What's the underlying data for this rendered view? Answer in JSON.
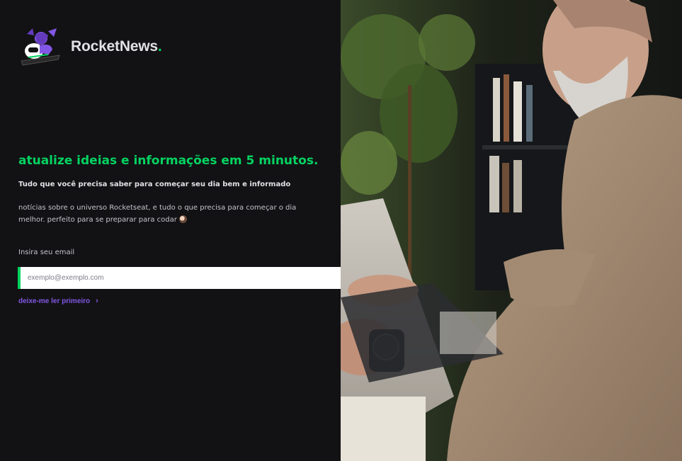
{
  "brand": {
    "name": "RocketNews",
    "dot": ".",
    "logo_icon": "rocket-astronaut-icon"
  },
  "hero": {
    "headline": "atualize ideias e informações em 5 minutos.",
    "subhead": "Tudo que você precisa saber para começar seu dia bem e informado",
    "description": "notícias sobre o universo Rocketseat, e tudo o que precisa para começar o dia melhor. perfeito para se preparar para codar"
  },
  "form": {
    "label": "Insira seu email",
    "placeholder": "exemplo@exemplo.com",
    "send_icon": "send-icon"
  },
  "link": {
    "label": "deixe-me ler primeiro",
    "chevron": "›"
  },
  "colors": {
    "accent_green": "#04d361",
    "accent_purple": "#8257e5",
    "background": "#121214"
  }
}
